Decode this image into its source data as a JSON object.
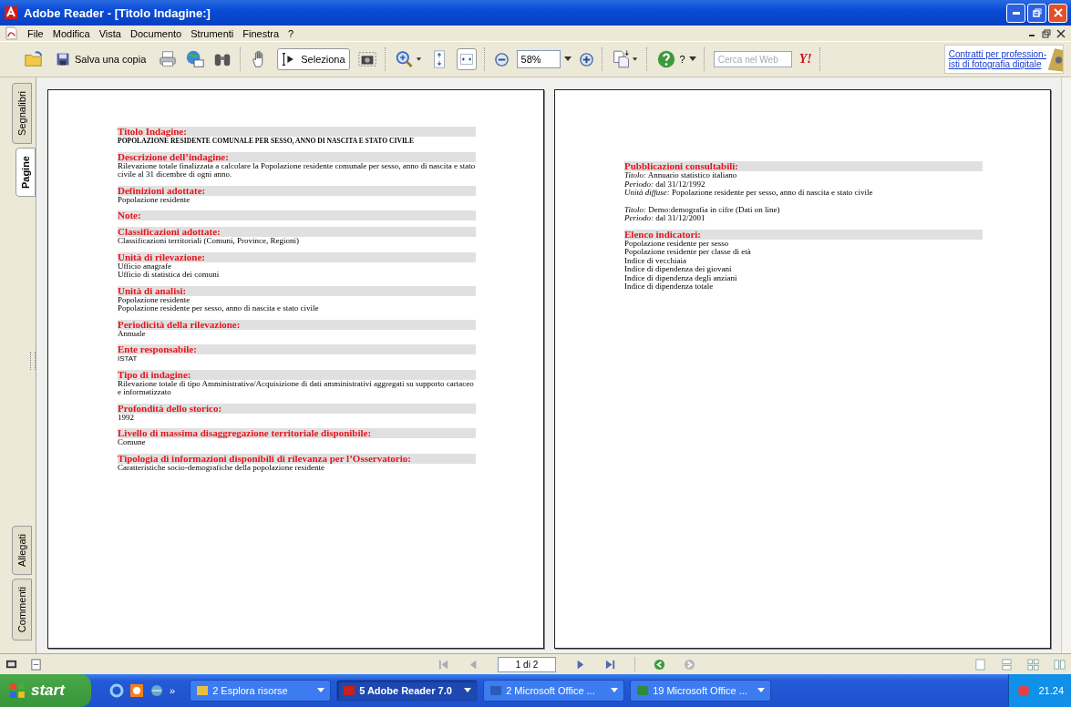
{
  "window": {
    "title": "Adobe Reader - [Titolo Indagine:]"
  },
  "menu": [
    "File",
    "Modifica",
    "Vista",
    "Documento",
    "Strumenti",
    "Finestra",
    "?"
  ],
  "toolbar": {
    "save_label": "Salva una copia",
    "select_tool": {
      "label": "Seleziona",
      "selected": true
    },
    "fit_width_selected": true,
    "zoom": "58%",
    "help": "?",
    "search_placeholder": "Cerca nel Web",
    "search_logo": "Y!",
    "ad_lines": [
      "Contratti per profession-",
      "isti di fotografia digitale"
    ]
  },
  "side_tabs": {
    "top": [
      {
        "label": "Segnalibri",
        "selected": false
      },
      {
        "label": "Pagine",
        "selected": true
      }
    ],
    "bottom": [
      {
        "label": "Allegati",
        "selected": false
      },
      {
        "label": "Commenti",
        "selected": false
      }
    ]
  },
  "pages": [
    {
      "sections": [
        {
          "heading": "Titolo Indagine:",
          "paragraphs": [
            {
              "kind": "title",
              "lines": [
                "POPOLAZIONE RESIDENTE COMUNALE PER SESSO, ANNO DI NASCITA E STATO CIVILE"
              ]
            }
          ]
        },
        {
          "heading": "Descrizione dell’indagine:",
          "paragraphs": [
            {
              "kind": "text",
              "lines": [
                "Rilevazione totale finalizzata a calcolare la Popolazione residente comunale per sesso, anno di nascita e stato civile al 31 dicembre di ogni anno."
              ]
            }
          ]
        },
        {
          "heading": "Definizioni adottate:",
          "paragraphs": [
            {
              "kind": "text",
              "lines": [
                "Popolazione residente"
              ]
            }
          ]
        },
        {
          "heading": "Note:"
        },
        {
          "heading": "Classificazioni adottate:",
          "paragraphs": [
            {
              "kind": "text",
              "lines": [
                "Classificazioni territoriali (Comuni, Province, Regioni)"
              ]
            }
          ]
        },
        {
          "heading": "Unità di rilevazione:",
          "paragraphs": [
            {
              "kind": "text",
              "lines": [
                "Ufficio anagrafe",
                "Ufficio di statistica dei comuni"
              ]
            }
          ]
        },
        {
          "heading": "Unità di analisi:",
          "paragraphs": [
            {
              "kind": "text",
              "lines": [
                "Popolazione residente",
                "Popolazione residente per sesso, anno di nascita e stato civile"
              ]
            }
          ]
        },
        {
          "heading": "Periodicità della rilevazione:",
          "paragraphs": [
            {
              "kind": "text",
              "lines": [
                "Annuale"
              ]
            }
          ]
        },
        {
          "heading": "Ente responsabile:",
          "paragraphs": [
            {
              "kind": "sans",
              "lines": [
                "ISTAT"
              ]
            }
          ]
        },
        {
          "heading": "Tipo di indagine:",
          "paragraphs": [
            {
              "kind": "text",
              "lines": [
                "Rilevazione totale di tipo Amministrativa/Acquisizione di dati amministrativi aggregati su supporto cartaceo e informatizzato"
              ]
            }
          ]
        },
        {
          "heading": "Profondità dello storico:",
          "paragraphs": [
            {
              "kind": "text",
              "lines": [
                "1992"
              ]
            }
          ]
        },
        {
          "heading": "Livello di massima disaggregazione territoriale disponibile:",
          "paragraphs": [
            {
              "kind": "text",
              "lines": [
                "Comune"
              ]
            }
          ]
        },
        {
          "heading": "Tipologia di informazioni disponibili di rilevanza per l’Osservatorio:",
          "paragraphs": [
            {
              "kind": "text",
              "lines": [
                "Caratteristiche socio-demografiche della popolazione residente"
              ]
            }
          ]
        }
      ]
    },
    {
      "sections": [
        {
          "heading": "Pubblicazioni consultabili:",
          "paragraphs": [
            {
              "kind": "text",
              "lines": [
                "*Titolo:* Annuario statistico italiano",
                "*Periodo:* dal 31/12/1992",
                "*Unità diffuse:* Popolazione residente per sesso, anno di nascita e stato civile"
              ]
            },
            {
              "kind": "text",
              "lines": [
                "*Titolo:* Demo:demografia in cifre (Dati on line)",
                "*Periodo:* dal 31/12/2001"
              ]
            }
          ]
        },
        {
          "heading": "Elenco indicatori:",
          "paragraphs": [
            {
              "kind": "text",
              "lines": [
                "Popolazione residente per sesso",
                "Popolazione residente per classe di età",
                "Indice di vecchiaia",
                "Indice di dipendenza dei giovani",
                "Indice di dipendenza degli anziani",
                "Indice di dipendenza totale"
              ]
            }
          ]
        }
      ]
    }
  ],
  "navigation": {
    "page": "1 di 2"
  },
  "taskbar": {
    "start": "start",
    "more": "»",
    "tasks": [
      {
        "label": "2 Esplora risorse",
        "kind": "folder",
        "selected": false
      },
      {
        "label": "5 Adobe Reader 7.0",
        "kind": "reader",
        "selected": true
      },
      {
        "label": "2 Microsoft Office ...",
        "kind": "word",
        "selected": false
      },
      {
        "label": "19 Microsoft Office ...",
        "kind": "excel",
        "selected": false
      }
    ],
    "clock": "21.24"
  }
}
